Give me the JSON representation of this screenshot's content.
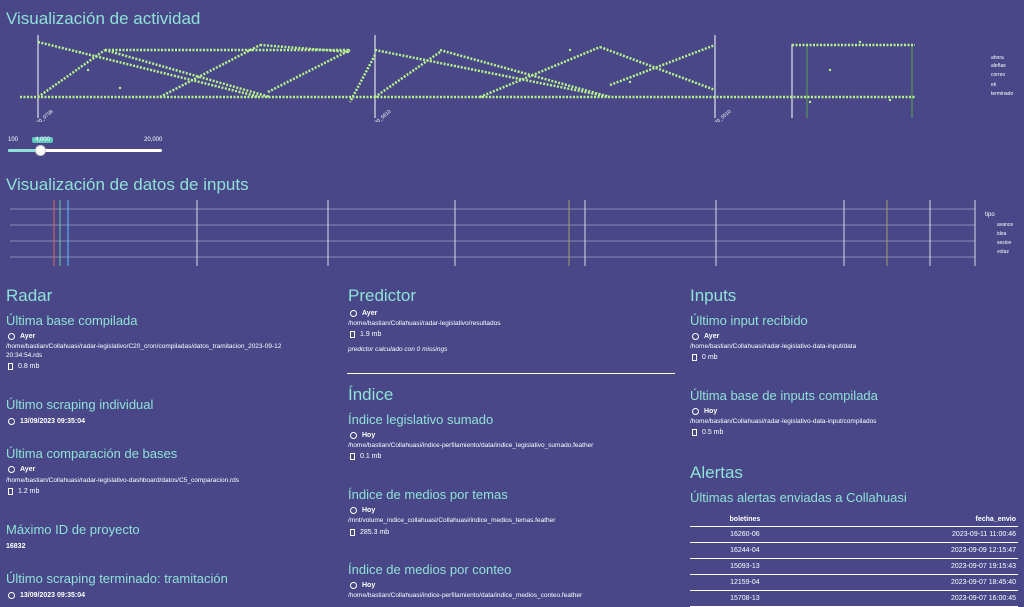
{
  "activity": {
    "title": "Visualización de actividad",
    "legend": [
      "ahora",
      "aleñas",
      "correo",
      "ek",
      "terminado"
    ],
    "axis_labels": [
      "1230_0738",
      "1230_5610",
      "1230_5510"
    ],
    "slider": {
      "min": "100",
      "max": "20,000",
      "value": "4,000",
      "fraction": 0.2
    }
  },
  "inputs_viz": {
    "title": "Visualización de datos de inputs",
    "legend_title": "tipo",
    "legend": [
      "avance",
      "idea",
      "sesion",
      "votaz"
    ]
  },
  "radar": {
    "title": "Radar",
    "ultima_base": {
      "heading": "Última base compilada",
      "when": "Ayer",
      "path": "/home/bastian/Collahuasi/radar-legislativo/C20_cron/compiladas/datos_tramitacion_2023-09-12 20:34:54.rds",
      "size": "0.8 mb"
    },
    "scraping_individual": {
      "heading": "Último scraping individual",
      "when": "13/09/2023 09:35:04"
    },
    "comparacion": {
      "heading": "Última comparación de bases",
      "when": "Ayer",
      "path": "/home/bastian/Collahuasi/radar-legislativo-dashboard/datos/C5_comparacion.rds",
      "size": "1.2 mb"
    },
    "maximo_id": {
      "heading": "Máximo ID de proyecto",
      "value": "16832"
    },
    "scraping_terminado": {
      "heading": "Último scraping terminado: tramitación",
      "when": "13/09/2023 09:35:04"
    }
  },
  "predictor": {
    "title": "Predictor",
    "when": "Ayer",
    "path": "/home/bastian/Collahuasi/radar-legislativo/resultados",
    "size": "1.9 mb",
    "note": "predictor calculado con 0 missings"
  },
  "indice": {
    "title": "Índice",
    "sumado": {
      "heading": "Índice legislativo sumado",
      "when": "Hoy",
      "path": "/home/bastian/Collahuasi/indice-perfilamiento/data/indice_legislativo_sumado.feather",
      "size": "0.1 mb"
    },
    "temas": {
      "heading": "Índice de medios por temas",
      "when": "Hoy",
      "path": "/mnt/volume_indice_collahuasi/Collahuasi/indice_medios_temas.feather",
      "size": "285.3 mb"
    },
    "conteo": {
      "heading": "Índice de medios por conteo",
      "when": "Hoy",
      "path": "/home/bastian/Collahuasi/indice-perfilamiento/data/indice_medios_conteo.feather"
    }
  },
  "inputs": {
    "title": "Inputs",
    "ultimo_input": {
      "heading": "Último input recibido",
      "when": "Ayer",
      "path": "/home/bastian/Collahuasi/radar-legislativo-data-input/data",
      "size": "0 mb"
    },
    "ultima_base": {
      "heading": "Última base de inputs compilada",
      "when": "Hoy",
      "path": "/home/bastian/Collahuasi/radar-legislativo-data-input/compilados",
      "size": "0.5 mb"
    }
  },
  "alertas": {
    "title": "Alertas",
    "subtitle": "Últimas alertas enviadas a Collahuasi",
    "columns": [
      "boletines",
      "fecha_envio"
    ],
    "rows": [
      [
        "16260-06",
        "2023-09-11 11:00:46"
      ],
      [
        "16244-04",
        "2023-09-09 12:15:47"
      ],
      [
        "15093-13",
        "2023-09-07 19:15:43"
      ],
      [
        "12159-04",
        "2023-09-07 18:45:40"
      ],
      [
        "15708-13",
        "2023-09-07 16:00:45"
      ]
    ]
  },
  "colors": {
    "background": "#4a4789",
    "accent": "#8fe0d6",
    "series": "#b6f08a"
  }
}
